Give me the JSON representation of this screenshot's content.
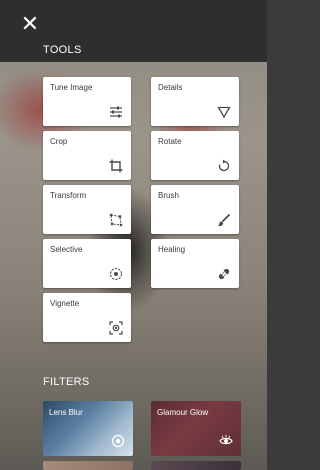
{
  "header": {
    "close_icon": "close-icon"
  },
  "tools": {
    "section_title": "TOOLS",
    "items": [
      {
        "label": "Tune Image",
        "icon": "sliders-icon"
      },
      {
        "label": "Details",
        "icon": "triangle-down-icon"
      },
      {
        "label": "Crop",
        "icon": "crop-icon"
      },
      {
        "label": "Rotate",
        "icon": "rotate-icon"
      },
      {
        "label": "Transform",
        "icon": "transform-icon"
      },
      {
        "label": "Brush",
        "icon": "brush-icon"
      },
      {
        "label": "Selective",
        "icon": "selective-icon"
      },
      {
        "label": "Healing",
        "icon": "bandage-icon"
      },
      {
        "label": "Vignette",
        "icon": "vignette-icon"
      }
    ]
  },
  "filters": {
    "section_title": "FILTERS",
    "items": [
      {
        "label": "Lens Blur",
        "icon": "target-icon"
      },
      {
        "label": "Glamour Glow",
        "icon": "eye-icon"
      }
    ]
  },
  "colors": {
    "tile_bg": "#ffffff",
    "panel_bg": "#2e2e2e",
    "text_light": "#ffffff",
    "icon": "#4a4a4a"
  }
}
